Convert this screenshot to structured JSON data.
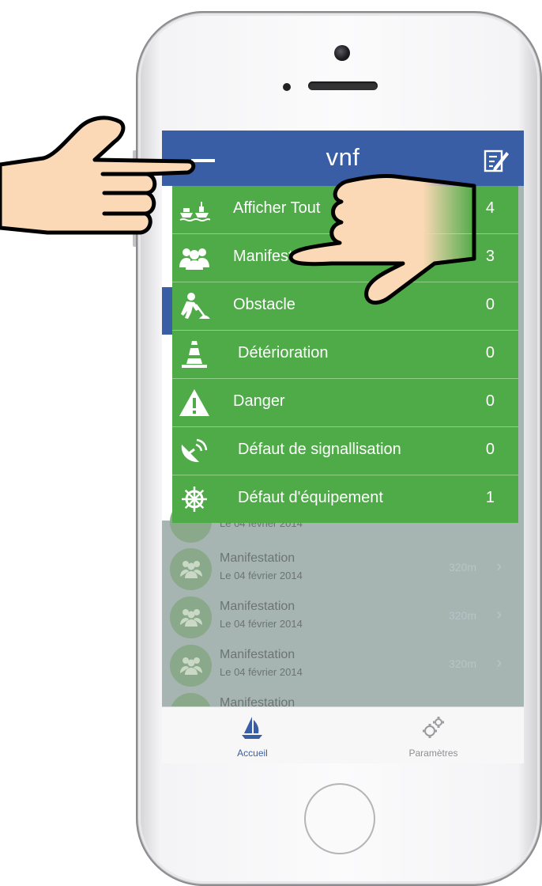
{
  "nav": {
    "title": "vnf"
  },
  "menu": {
    "items": [
      {
        "label": "Afficher Tout",
        "count": "4",
        "icon": "boats-icon"
      },
      {
        "label": "Manifestation",
        "count": "3",
        "icon": "crowd-icon"
      },
      {
        "label": "Obstacle",
        "count": "0",
        "icon": "worker-icon"
      },
      {
        "label": "Détérioration",
        "count": "0",
        "icon": "traffic-cone-icon"
      },
      {
        "label": "Danger",
        "count": "0",
        "icon": "warning-icon"
      },
      {
        "label": "Défaut de signallisation",
        "count": "0",
        "icon": "satellite-dish-icon"
      },
      {
        "label": "Défaut d'équipement",
        "count": "1",
        "icon": "ship-wheel-icon"
      }
    ]
  },
  "list": {
    "rows": [
      {
        "title": "",
        "date": "Le 04 février 2014",
        "distance": ""
      },
      {
        "title": "Manifestation",
        "date": "Le 04 février 2014",
        "distance": "320m"
      },
      {
        "title": "Manifestation",
        "date": "Le 04 février 2014",
        "distance": "320m"
      },
      {
        "title": "Manifestation",
        "date": "Le 04 février 2014",
        "distance": "320m"
      },
      {
        "title": "Manifestation",
        "date": "",
        "distance": ""
      }
    ]
  },
  "tabs": {
    "home": "Accueil",
    "settings": "Paramètres"
  },
  "colors": {
    "nav_blue": "#3a5ea5",
    "menu_green": "#4faa48",
    "list_overlay": "#a6b5b2"
  }
}
